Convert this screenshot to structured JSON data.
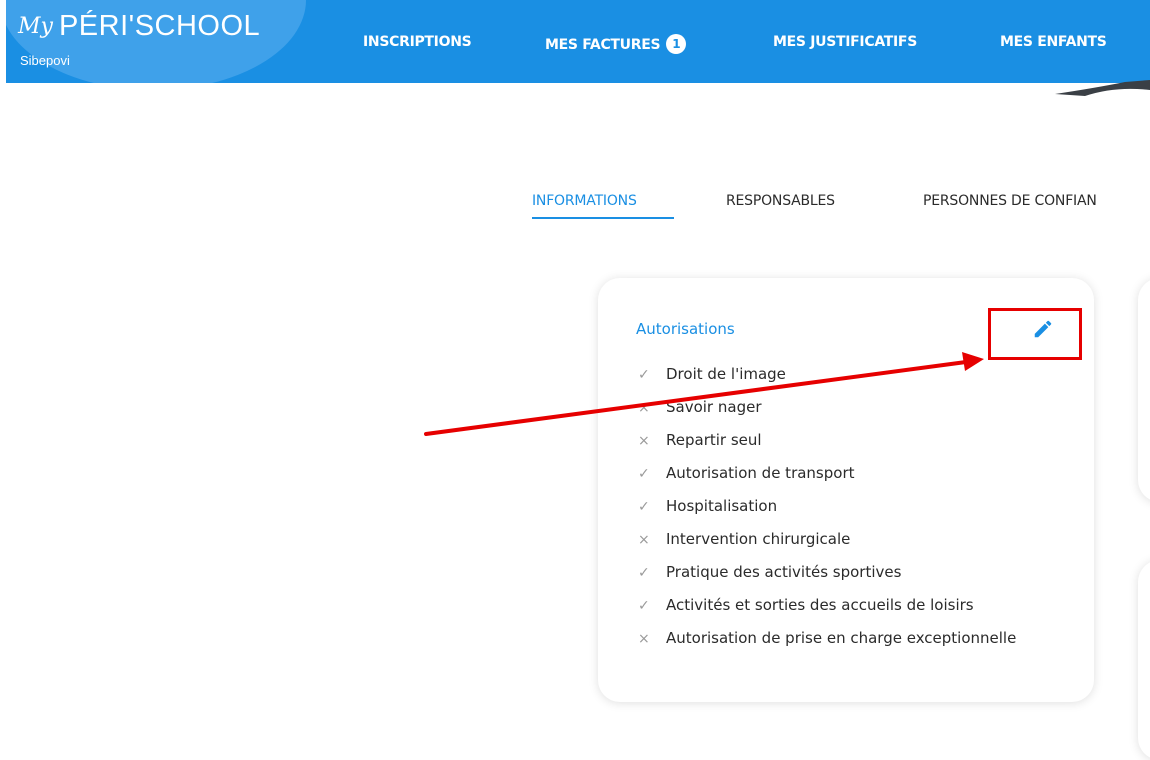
{
  "header": {
    "logo_prefix": "My",
    "logo_name": "PÉRI'SCHOOL",
    "subtitle": "Sibepovi",
    "nav": [
      {
        "label": "INSCRIPTIONS"
      },
      {
        "label": "MES FACTURES",
        "badge": "1"
      },
      {
        "label": "MES JUSTIFICATIFS"
      },
      {
        "label": "MES ENFANTS"
      }
    ]
  },
  "tabs": [
    {
      "label": "INFORMATIONS",
      "active": true
    },
    {
      "label": "RESPONSABLES",
      "active": false
    },
    {
      "label": "PERSONNES DE CONFIAN",
      "active": false
    }
  ],
  "card": {
    "title": "Autorisations",
    "edit_icon": "pencil-icon",
    "items": [
      {
        "label": "Droit de l'image",
        "granted": true,
        "mark": "✓"
      },
      {
        "label": "Savoir nager",
        "granted": false,
        "mark": "×"
      },
      {
        "label": "Repartir seul",
        "granted": false,
        "mark": "×"
      },
      {
        "label": "Autorisation de transport",
        "granted": true,
        "mark": "✓"
      },
      {
        "label": "Hospitalisation",
        "granted": true,
        "mark": "✓"
      },
      {
        "label": "Intervention chirurgicale",
        "granted": false,
        "mark": "×"
      },
      {
        "label": "Pratique des activités sportives",
        "granted": true,
        "mark": "✓"
      },
      {
        "label": "Activités et sorties des accueils de loisirs",
        "granted": true,
        "mark": "✓"
      },
      {
        "label": "Autorisation de prise en charge exceptionnelle",
        "granted": false,
        "mark": "×"
      }
    ]
  },
  "colors": {
    "primary": "#1a8fe3",
    "annotation": "#e60000"
  }
}
